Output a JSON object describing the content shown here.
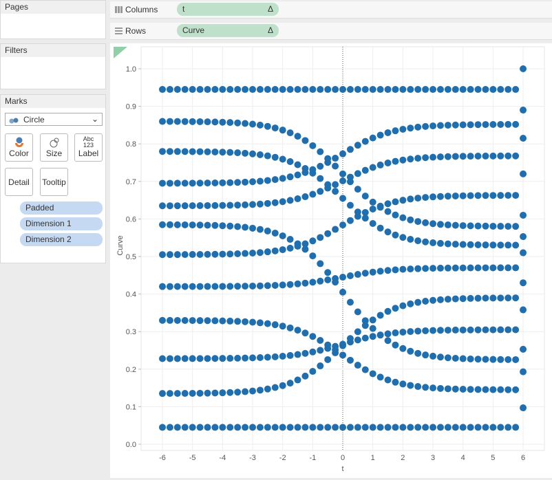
{
  "panels": {
    "pages": "Pages",
    "filters": "Filters",
    "marks": "Marks"
  },
  "marks": {
    "type": "Circle",
    "buttons": {
      "color": "Color",
      "size": "Size",
      "label": "Label",
      "label_icon_top": "Abc",
      "label_icon_bottom": "123",
      "detail": "Detail",
      "tooltip": "Tooltip"
    },
    "fields": [
      "Padded",
      "Dimension 1",
      "Dimension 2"
    ]
  },
  "shelves": {
    "columns_label": "Columns",
    "columns_pill": "t",
    "rows_label": "Rows",
    "rows_pill": "Curve",
    "delta": "Δ"
  },
  "colors": {
    "mark": "#1f6fb0"
  },
  "chart_data": {
    "type": "scatter",
    "xlabel": "t",
    "ylabel": "Curve",
    "xlim": [
      -6.6,
      6.7
    ],
    "ylim": [
      0,
      1.0
    ],
    "xticks": [
      "-6",
      "-5",
      "-4",
      "-3",
      "-2",
      "-1",
      "0",
      "1",
      "2",
      "3",
      "4",
      "5",
      "6"
    ],
    "yticks": [
      "0.0",
      "0.1",
      "0.2",
      "0.3",
      "0.4",
      "0.5",
      "0.6",
      "0.7",
      "0.8",
      "0.9",
      "1.0"
    ],
    "grid": true,
    "t_start": -6,
    "t_end": 5.75,
    "t_step": 0.25,
    "steepness": 1.2,
    "series": [
      {
        "start": 0.945,
        "end": 0.945
      },
      {
        "start": 0.86,
        "end": 0.58
      },
      {
        "start": 0.78,
        "end": 0.53
      },
      {
        "start": 0.695,
        "end": 0.852
      },
      {
        "start": 0.635,
        "end": 0.768
      },
      {
        "start": 0.585,
        "end": 0.225
      },
      {
        "start": 0.505,
        "end": 0.663
      },
      {
        "start": 0.42,
        "end": 0.47
      },
      {
        "start": 0.33,
        "end": 0.145
      },
      {
        "start": 0.228,
        "end": 0.305
      },
      {
        "start": 0.135,
        "end": 0.39
      },
      {
        "start": 0.045,
        "end": 0.045
      }
    ],
    "t6_values": [
      1.0,
      0.89,
      0.815,
      0.72,
      0.61,
      0.553,
      0.51,
      0.43,
      0.358,
      0.253,
      0.193,
      0.097
    ]
  }
}
